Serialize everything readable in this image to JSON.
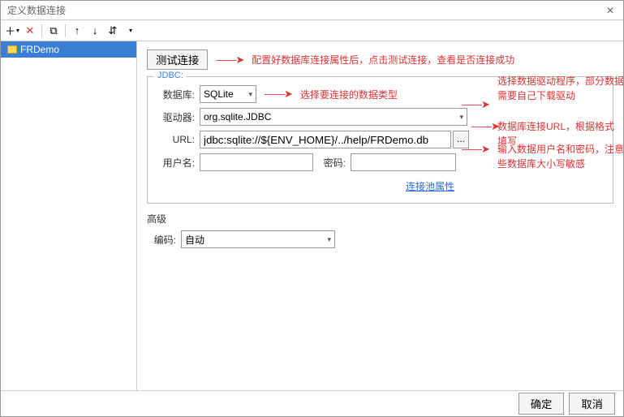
{
  "window": {
    "title": "定义数据连接"
  },
  "toolbar": {
    "add": "＋",
    "add_chev": "▾",
    "del": "✕",
    "copy": "⧉",
    "up": "↑",
    "down": "↓",
    "sort": "⇵",
    "more": "▾"
  },
  "sidebar": {
    "items": [
      {
        "label": "FRDemo"
      }
    ]
  },
  "test": {
    "btn": "测试连接",
    "hint": "配置好数据库连接属性后，点击测试连接，查看是否连接成功"
  },
  "jdbc": {
    "legend": "JDBC:",
    "db_label": "数据库:",
    "db_value": "SQLite",
    "db_hint": "选择要连接的数据类型",
    "driver_label": "驱动器:",
    "driver_value": "org.sqlite.JDBC",
    "url_label": "URL:",
    "url_value": "jdbc:sqlite://${ENV_HOME}/../help/FRDemo.db",
    "url_btn": "...",
    "user_label": "用户名:",
    "user_value": "",
    "pwd_label": "密码:",
    "pwd_value": "",
    "pool_link": "连接池属性"
  },
  "side_hints": {
    "driver": "选择数据驱动程序，部分数据库需要自己下载驱动",
    "url": "数据库连接URL，根据格式填写",
    "user": "输入数据用户名和密码，注意有些数据库大小写敏感"
  },
  "advanced": {
    "label": "高级",
    "enc_label": "编码:",
    "enc_value": "自动"
  },
  "footer": {
    "ok": "确定",
    "cancel": "取消"
  },
  "arrow": "——➤"
}
